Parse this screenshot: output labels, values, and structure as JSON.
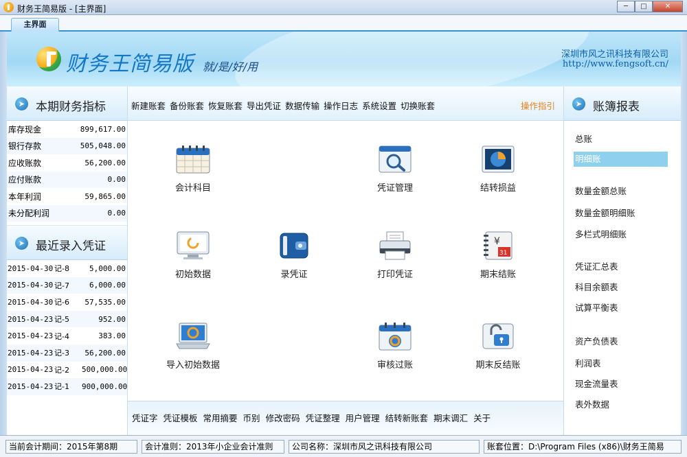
{
  "window": {
    "title": "财务王简易版 - [主界面]",
    "controls": [
      "minimize",
      "maximize",
      "close"
    ]
  },
  "tabs": [
    {
      "label": "主界面",
      "active": true
    }
  ],
  "banner": {
    "product": "财务王简易版",
    "slogan": "就/是/好/用",
    "company": "深圳市风之讯科技有限公司",
    "url": "http://www.fengsoft.cn/"
  },
  "left": {
    "metrics_title": "本期财务指标",
    "metrics": [
      {
        "label": "库存现金",
        "value": "899,617.00"
      },
      {
        "label": "银行存款",
        "value": "505,048.00"
      },
      {
        "label": "应收账款",
        "value": "56,200.00"
      },
      {
        "label": "应付账款",
        "value": "0.00"
      },
      {
        "label": "本年利润",
        "value": "59,865.00"
      },
      {
        "label": "未分配利润",
        "value": "0.00"
      }
    ],
    "vouchers_title": "最近录入凭证",
    "vouchers": [
      {
        "date": "2015-04-30",
        "no": "记-8",
        "amount": "5,000.00"
      },
      {
        "date": "2015-04-30",
        "no": "记-7",
        "amount": "6,000.00"
      },
      {
        "date": "2015-04-30",
        "no": "记-6",
        "amount": "57,535.00"
      },
      {
        "date": "2015-04-23",
        "no": "记-5",
        "amount": "952.00"
      },
      {
        "date": "2015-04-23",
        "no": "记-4",
        "amount": "383.00"
      },
      {
        "date": "2015-04-23",
        "no": "记-3",
        "amount": "56,200.00"
      },
      {
        "date": "2015-04-23",
        "no": "记-2",
        "amount": "500,000.00"
      },
      {
        "date": "2015-04-23",
        "no": "记-1",
        "amount": "900,000.00"
      }
    ]
  },
  "toolbar": {
    "items": [
      "新建账套",
      "备份账套",
      "恢复账套",
      "导出凭证",
      "数据传输",
      "操作日志",
      "系统设置",
      "切换账套"
    ],
    "guide": "操作指引"
  },
  "icons": [
    {
      "name": "accounts",
      "label": "会计科目",
      "icon": "calendar-icon"
    },
    {
      "name": "voucher-mgmt",
      "label": "凭证管理",
      "icon": "magnifier-icon"
    },
    {
      "name": "transfer-pl",
      "label": "结转损益",
      "icon": "pie-chart-icon"
    },
    {
      "name": "initial-data",
      "label": "初始数据",
      "icon": "monitor-icon"
    },
    {
      "name": "enter-voucher",
      "label": "录凭证",
      "icon": "wallet-icon"
    },
    {
      "name": "print-voucher",
      "label": "打印凭证",
      "icon": "printer-icon"
    },
    {
      "name": "period-close",
      "label": "期末结账",
      "icon": "ledger-icon"
    },
    {
      "name": "import-initial",
      "label": "导入初始数据",
      "icon": "laptop-sync-icon"
    },
    {
      "name": "review-post",
      "label": "审核过账",
      "icon": "calendar-sync-icon"
    },
    {
      "name": "reverse-close",
      "label": "期末反结账",
      "icon": "unlock-icon"
    }
  ],
  "bottom": {
    "items": [
      "凭证字",
      "凭证模板",
      "常用摘要",
      "币别",
      "修改密码",
      "凭证整理",
      "用户管理",
      "结转新账套",
      "期末调汇",
      "关于"
    ]
  },
  "right": {
    "title": "账簿报表",
    "items": [
      {
        "label": "总账"
      },
      {
        "label": "明细账",
        "selected": true
      },
      {
        "label": "数量金额总账"
      },
      {
        "label": "数量金额明细账"
      },
      {
        "label": "多栏式明细账"
      },
      {
        "label": "凭证汇总表"
      },
      {
        "label": "科目余额表"
      },
      {
        "label": "试算平衡表"
      },
      {
        "label": "资产负债表"
      },
      {
        "label": "利润表"
      },
      {
        "label": "现金流量表"
      },
      {
        "label": "表外数据"
      }
    ]
  },
  "status": {
    "period": "当前会计期间：2015年第8期",
    "standard": "会计准则：2013年小企业会计准则",
    "company": "公司名称：深圳市风之讯科技有限公司",
    "location": "账套位置：D:\\Program Files (x86)\\财务王简易"
  },
  "colors": {
    "accent": "#1377c7",
    "guide_orange": "#e8811c",
    "selected_bg": "#8fd0ef"
  }
}
